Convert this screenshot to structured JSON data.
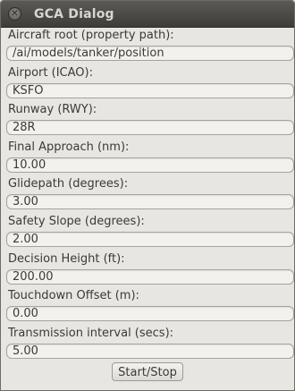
{
  "window": {
    "title": "GCA Dialog",
    "close_icon": "close-icon"
  },
  "fields": [
    {
      "label": "Aircraft root (property path):",
      "value": "/ai/models/tanker/position"
    },
    {
      "label": "Airport (ICAO):",
      "value": "KSFO"
    },
    {
      "label": "Runway (RWY):",
      "value": "28R"
    },
    {
      "label": "Final Approach (nm):",
      "value": "10.00"
    },
    {
      "label": "Glidepath (degrees):",
      "value": "3.00"
    },
    {
      "label": "Safety Slope (degrees):",
      "value": "2.00"
    },
    {
      "label": "Decision Height (ft):",
      "value": "200.00"
    },
    {
      "label": "Touchdown Offset (m):",
      "value": "0.00"
    },
    {
      "label": "Transmission interval (secs):",
      "value": "5.00"
    }
  ],
  "actions": {
    "start_stop_label": "Start/Stop"
  }
}
